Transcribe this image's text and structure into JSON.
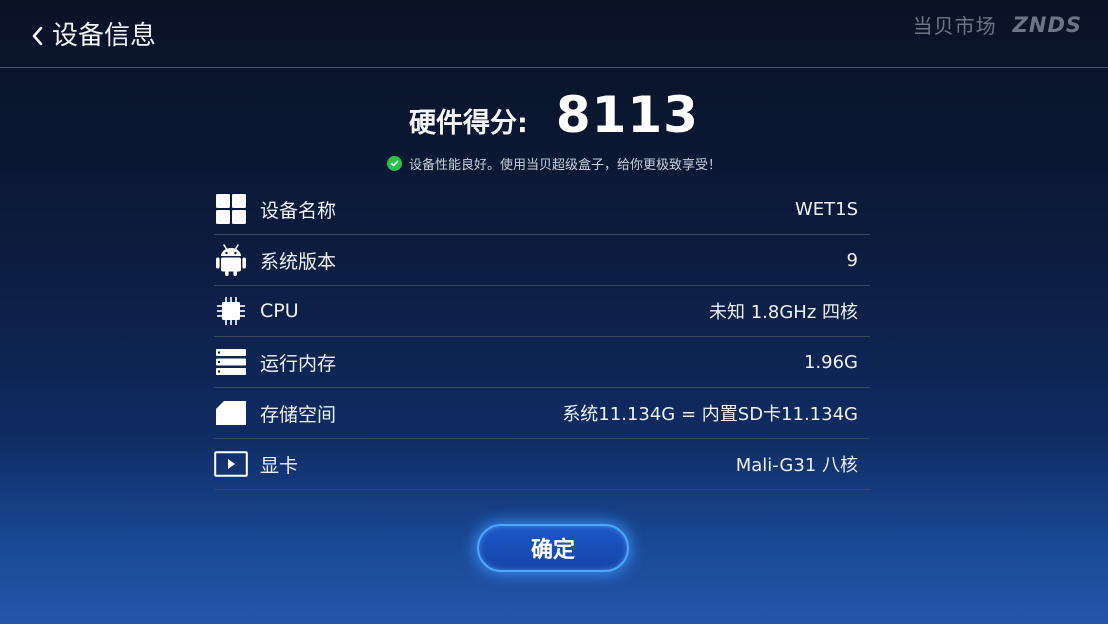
{
  "header": {
    "title": "设备信息",
    "brand_cn": "当贝市场",
    "brand_en": "ZNDS"
  },
  "score": {
    "label": "硬件得分:",
    "value": "8113"
  },
  "tip": "设备性能良好。使用当贝超级盒子，给你更极致享受！",
  "rows": [
    {
      "icon": "windows-icon",
      "name": "设备名称",
      "value": "WET1S"
    },
    {
      "icon": "android-icon",
      "name": "系统版本",
      "value": "9"
    },
    {
      "icon": "cpu-chip-icon",
      "name": "CPU",
      "value": "未知 1.8GHz 四核"
    },
    {
      "icon": "memory-icon",
      "name": "运行内存",
      "value": "1.96G"
    },
    {
      "icon": "sd-card-icon",
      "name": "存储空间",
      "value": "系统11.134G = 内置SD卡11.134G"
    },
    {
      "icon": "play-screen-icon",
      "name": "显卡",
      "value": "Mali-G31 八核"
    }
  ],
  "confirm_label": "确定",
  "colors": {
    "accent": "#4aa8ff",
    "button": "#1d57c9",
    "check": "#27c24c"
  }
}
